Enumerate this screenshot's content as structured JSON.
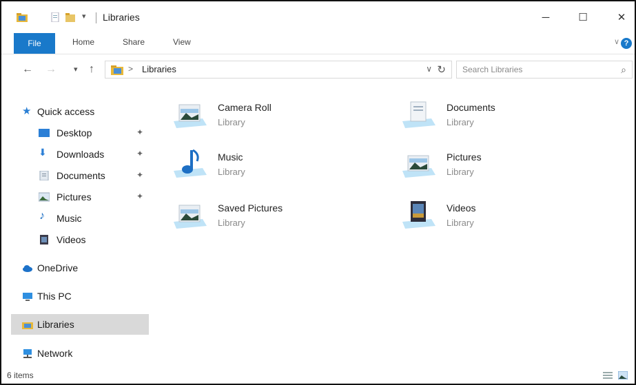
{
  "window": {
    "title": "Libraries"
  },
  "title_controls": {
    "minimize": "─",
    "maximize": "☐",
    "close": "✕"
  },
  "ribbon": {
    "tabs": [
      "File",
      "Home",
      "Share",
      "View"
    ],
    "collapse_glyph": "∨",
    "help_glyph": "?"
  },
  "nav": {
    "back": "←",
    "forward": "→",
    "recent": "▾",
    "up": "↑"
  },
  "address": {
    "chevron": ">",
    "path": "Libraries",
    "dropdown": "∨",
    "refresh": "↻"
  },
  "search": {
    "placeholder": "Search Libraries",
    "icon_glyph": "⌕"
  },
  "sidebar": {
    "quick_access": {
      "label": "Quick access",
      "items": [
        {
          "label": "Desktop",
          "icon": "desktop-icon",
          "pinned": true
        },
        {
          "label": "Downloads",
          "icon": "download-icon",
          "pinned": true
        },
        {
          "label": "Documents",
          "icon": "documents-icon",
          "pinned": true
        },
        {
          "label": "Pictures",
          "icon": "pictures-icon",
          "pinned": true
        },
        {
          "label": "Music",
          "icon": "music-icon",
          "pinned": false
        },
        {
          "label": "Videos",
          "icon": "videos-icon",
          "pinned": false
        }
      ]
    },
    "onedrive": "OneDrive",
    "this_pc": "This PC",
    "libraries": "Libraries",
    "network": "Network",
    "pin_glyph": "✦"
  },
  "libraries": [
    {
      "name": "Camera Roll",
      "type": "Library",
      "icon": "camera-roll-icon"
    },
    {
      "name": "Documents",
      "type": "Library",
      "icon": "documents-library-icon"
    },
    {
      "name": "Music",
      "type": "Library",
      "icon": "music-library-icon"
    },
    {
      "name": "Pictures",
      "type": "Library",
      "icon": "pictures-library-icon"
    },
    {
      "name": "Saved Pictures",
      "type": "Library",
      "icon": "saved-pictures-icon"
    },
    {
      "name": "Videos",
      "type": "Library",
      "icon": "videos-library-icon"
    }
  ],
  "status": {
    "count": "6 items"
  },
  "colors": {
    "accent": "#1979ca",
    "selected": "#d9d9d9"
  }
}
